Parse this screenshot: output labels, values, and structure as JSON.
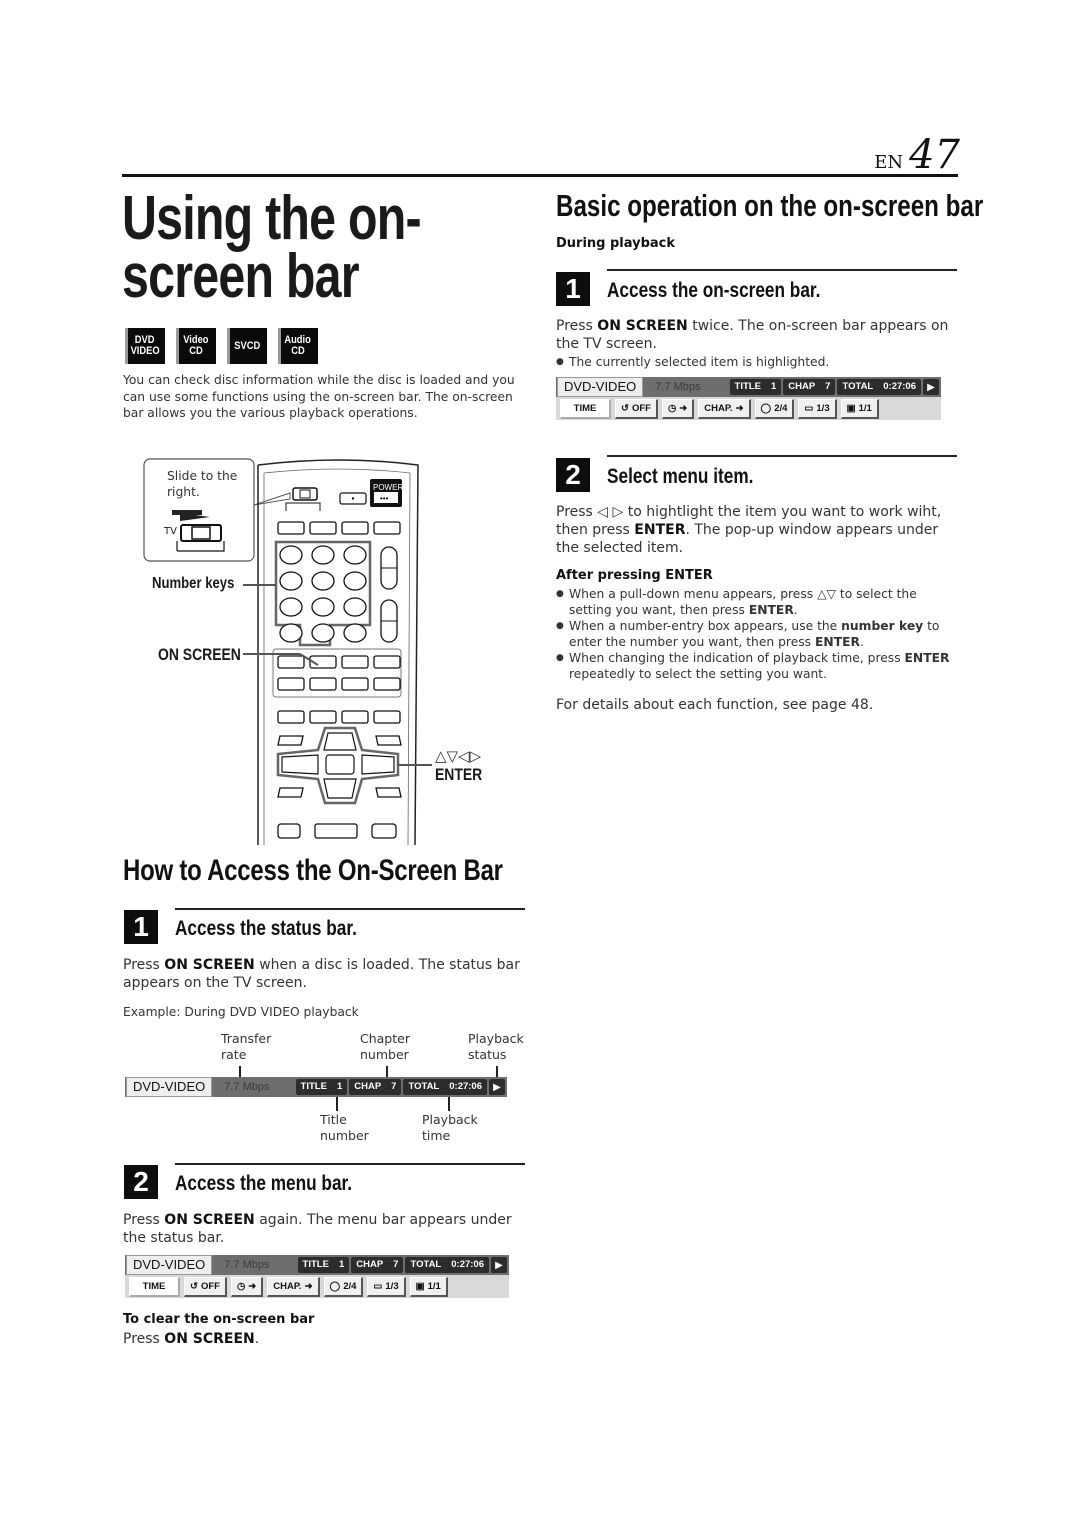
{
  "header": {
    "lang": "EN",
    "page_number": "47"
  },
  "title": {
    "line1": "Using the on-",
    "line2": "screen bar"
  },
  "disc_badges": [
    {
      "top": "DVD",
      "bottom": "VIDEO"
    },
    {
      "top": "Video",
      "bottom": "CD"
    },
    {
      "top": "SVCD",
      "bottom": ""
    },
    {
      "top": "Audio",
      "bottom": "CD"
    }
  ],
  "intro": "You can check disc information while the disc is loaded and you can use some functions using the on-screen bar. The on-screen bar allows you the various playback operations.",
  "remote": {
    "callout_slide": "Slide to the right.",
    "tv_label": "TV",
    "power_label": "POWER",
    "number_keys_label": "Number keys",
    "on_screen_label": "ON SCREEN",
    "arrows_label": "△▽◁▷",
    "enter_label": "ENTER"
  },
  "how_to": {
    "heading": "How to Access the On-Screen Bar",
    "step1": {
      "num": "1",
      "title": "Access the status bar.",
      "text_pre": "Press ",
      "text_bold": "ON SCREEN",
      "text_post": " when a disc is loaded. The status bar appears on the TV screen.",
      "example": "Example: During DVD VIDEO playback",
      "callouts": {
        "transfer_rate": "Transfer rate",
        "chapter_number": "Chapter number",
        "playback_status": "Playback status",
        "title_number": "Title number",
        "playback_time": "Playback time"
      }
    },
    "step2": {
      "num": "2",
      "title": "Access the menu bar.",
      "text_pre": "Press ",
      "text_bold": "ON SCREEN",
      "text_post": " again. The menu bar appears under the status bar.",
      "clear_heading": "To clear the on-screen bar",
      "clear_pre": "Press ",
      "clear_bold": "ON SCREEN",
      "clear_post": "."
    }
  },
  "basic_op": {
    "heading": "Basic operation on the on-screen bar",
    "subheading": "During playback",
    "step1": {
      "num": "1",
      "title": "Access the on-screen bar.",
      "text_pre": "Press ",
      "text_bold": "ON SCREEN",
      "text_post": " twice. The on-screen bar appears on the TV screen.",
      "bullet": "The currently selected item is highlighted."
    },
    "step2": {
      "num": "2",
      "title": "Select menu item.",
      "text_pre": "Press ◁ ▷ to hightlight the item you want to work wiht, then press ",
      "text_bold": "ENTER",
      "text_post": ". The pop-up window appears under the selected item.",
      "after_heading": "After pressing ENTER",
      "bullets": [
        {
          "pre": "When a pull-down menu appears, press △▽ to select the setting you want, then press ",
          "bold": "ENTER",
          "post": ".",
          "bold2": "",
          "post2": ""
        },
        {
          "pre": "When a number-entry box appears, use the ",
          "bold": "number key",
          "post": " to enter the number you want, then press ",
          "bold2": "ENTER",
          "post2": "."
        },
        {
          "pre": "When changing the indication of playback time, press ",
          "bold": "ENTER",
          "post": " repeatedly to select the setting you want.",
          "bold2": "",
          "post2": ""
        }
      ],
      "see_also": "For details about each function, see page 48."
    }
  },
  "osd": {
    "disc_type": "DVD-VIDEO",
    "transfer_rate": "7.7 Mbps",
    "title_label": "TITLE",
    "title_value": "1",
    "chap_label": "CHAP",
    "chap_value": "7",
    "total_label": "TOTAL",
    "total_value": "0:27:06",
    "play_status_icon": "play-icon",
    "menu": {
      "time": "TIME",
      "repeat": "OFF",
      "time_search_icon": "clock-arrow-icon",
      "chap": "CHAP.",
      "audio": "2/4",
      "subtitle": "1/3",
      "angle": "1/1"
    }
  }
}
